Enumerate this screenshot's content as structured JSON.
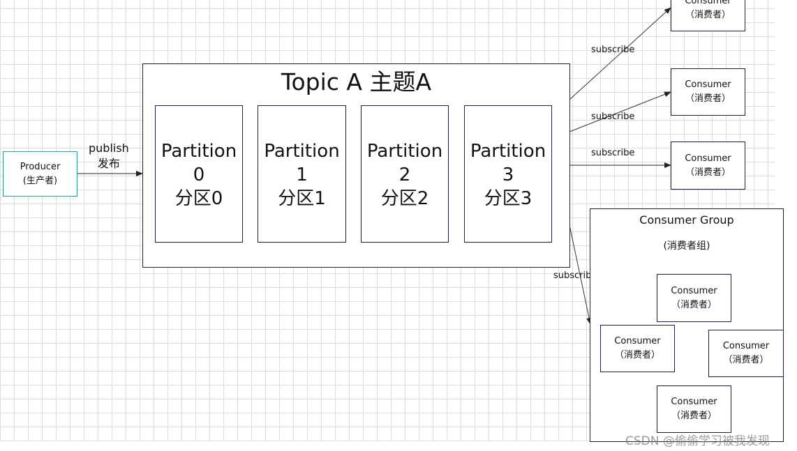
{
  "producer": {
    "name": "Producer",
    "cn": "(生产者)"
  },
  "publish": {
    "en": "publish",
    "cn": "发布"
  },
  "topic": {
    "title": "Topic A 主题A",
    "partitions": [
      {
        "en": "Partition",
        "num": "0",
        "cn": "分区0"
      },
      {
        "en": "Partition",
        "num": "1",
        "cn": "分区1"
      },
      {
        "en": "Partition",
        "num": "2",
        "cn": "分区2"
      },
      {
        "en": "Partition",
        "num": "3",
        "cn": "分区3"
      }
    ]
  },
  "subscribe_label": "subscribe",
  "consumer": {
    "name": "Consumer",
    "cn": "（消费者）"
  },
  "group": {
    "title": "Consumer Group",
    "subtitle": "(消费者组)"
  },
  "watermark": "CSDN @偷偷学习被我发现",
  "colors": {
    "producer_border": "#2e9a88",
    "box_border": "#1c1c4c",
    "grid": "#dcdcdc"
  }
}
